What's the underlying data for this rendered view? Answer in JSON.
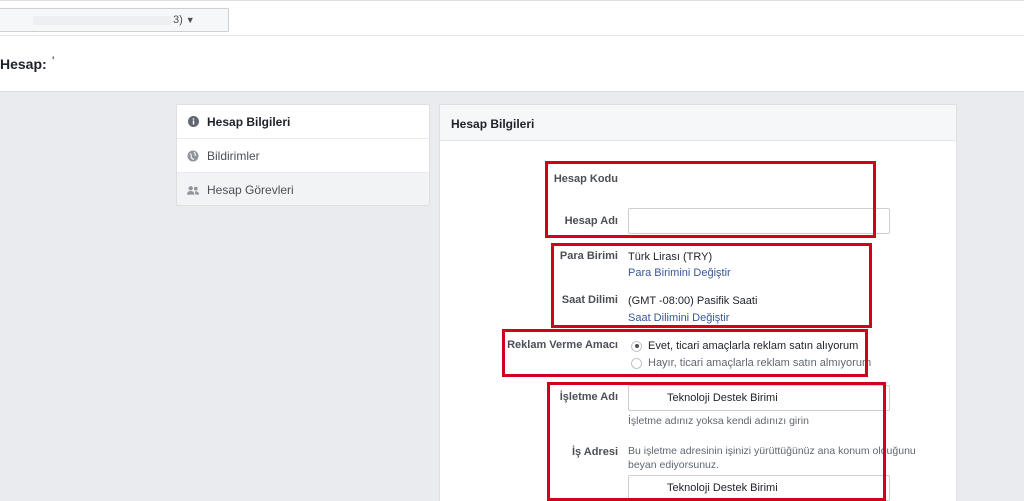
{
  "topbar": {
    "account_select_suffix": "3)"
  },
  "page": {
    "title": "Hesap:",
    "title_suffix": "'"
  },
  "sidebar": {
    "items": [
      {
        "label": "Hesap Bilgileri",
        "icon": "info-icon",
        "active": true
      },
      {
        "label": "Bildirimler",
        "icon": "globe-icon",
        "active": false
      },
      {
        "label": "Hesap Görevleri",
        "icon": "people-icon",
        "active": false
      }
    ]
  },
  "panel": {
    "title": "Hesap Bilgileri",
    "fields": {
      "account_id_label": "Hesap Kodu",
      "account_name_label": "Hesap Adı",
      "account_name_value": "",
      "currency_label": "Para Birimi",
      "currency_value": "Türk Lirası (TRY)",
      "currency_change": "Para Birimini Değiştir",
      "timezone_label": "Saat Dilimi",
      "timezone_value": "(GMT -08:00) Pasifik Saati",
      "timezone_change": "Saat Dilimini Değiştir",
      "purpose_label": "Reklam Verme Amacı",
      "purpose_yes": "Evet, ticari amaçlarla reklam satın alıyorum",
      "purpose_no": "Hayır, ticari amaçlarla reklam satın almıyorum",
      "business_name_label": "İşletme Adı",
      "business_name_value": "Teknoloji Destek Birimi",
      "business_name_hint": "İşletme adınız yoksa kendi adınızı girin",
      "business_address_label": "İş Adresi",
      "business_address_hint": "Bu işletme adresinin işinizi yürüttüğünüz ana konum olduğunu beyan ediyorsunuz.",
      "business_address_value": "Teknoloji Destek Birimi"
    }
  },
  "colors": {
    "highlight_border": "#d0021b",
    "link": "#365899",
    "background": "#e9ebee"
  }
}
